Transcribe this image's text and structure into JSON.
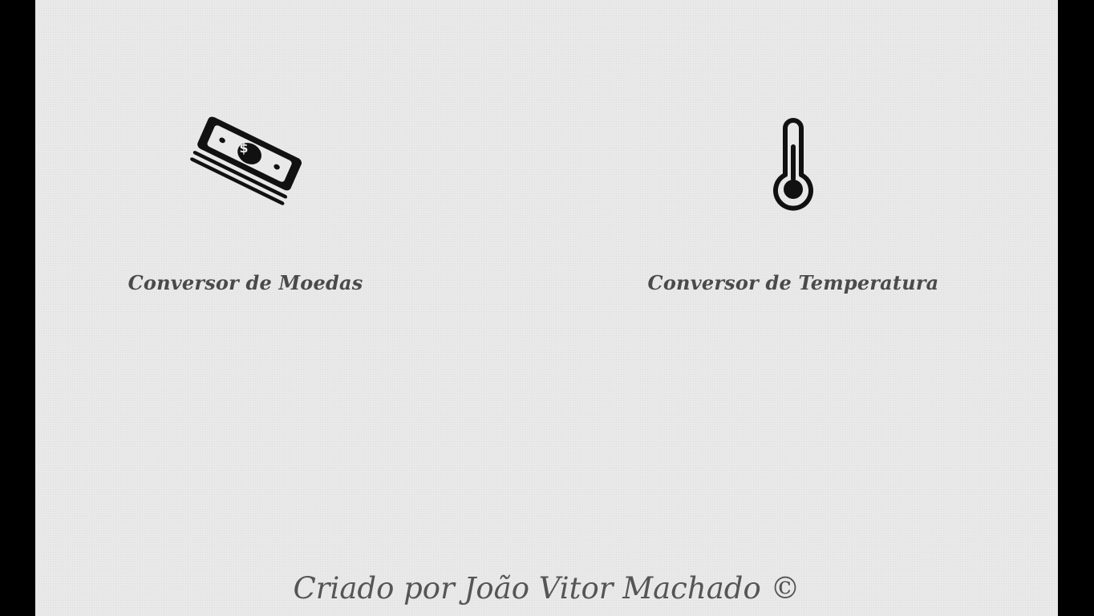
{
  "cards": [
    {
      "label": "Conversor de Moedas",
      "icon": "money-stack-icon"
    },
    {
      "label": "Conversor de Temperatura",
      "icon": "thermometer-icon"
    }
  ],
  "footer": {
    "text": "Criado por João Vitor Machado ©"
  },
  "colors": {
    "background": "#e9e9e9",
    "frame": "#000000",
    "label": "#4a4a4a",
    "icon": "#111111"
  }
}
